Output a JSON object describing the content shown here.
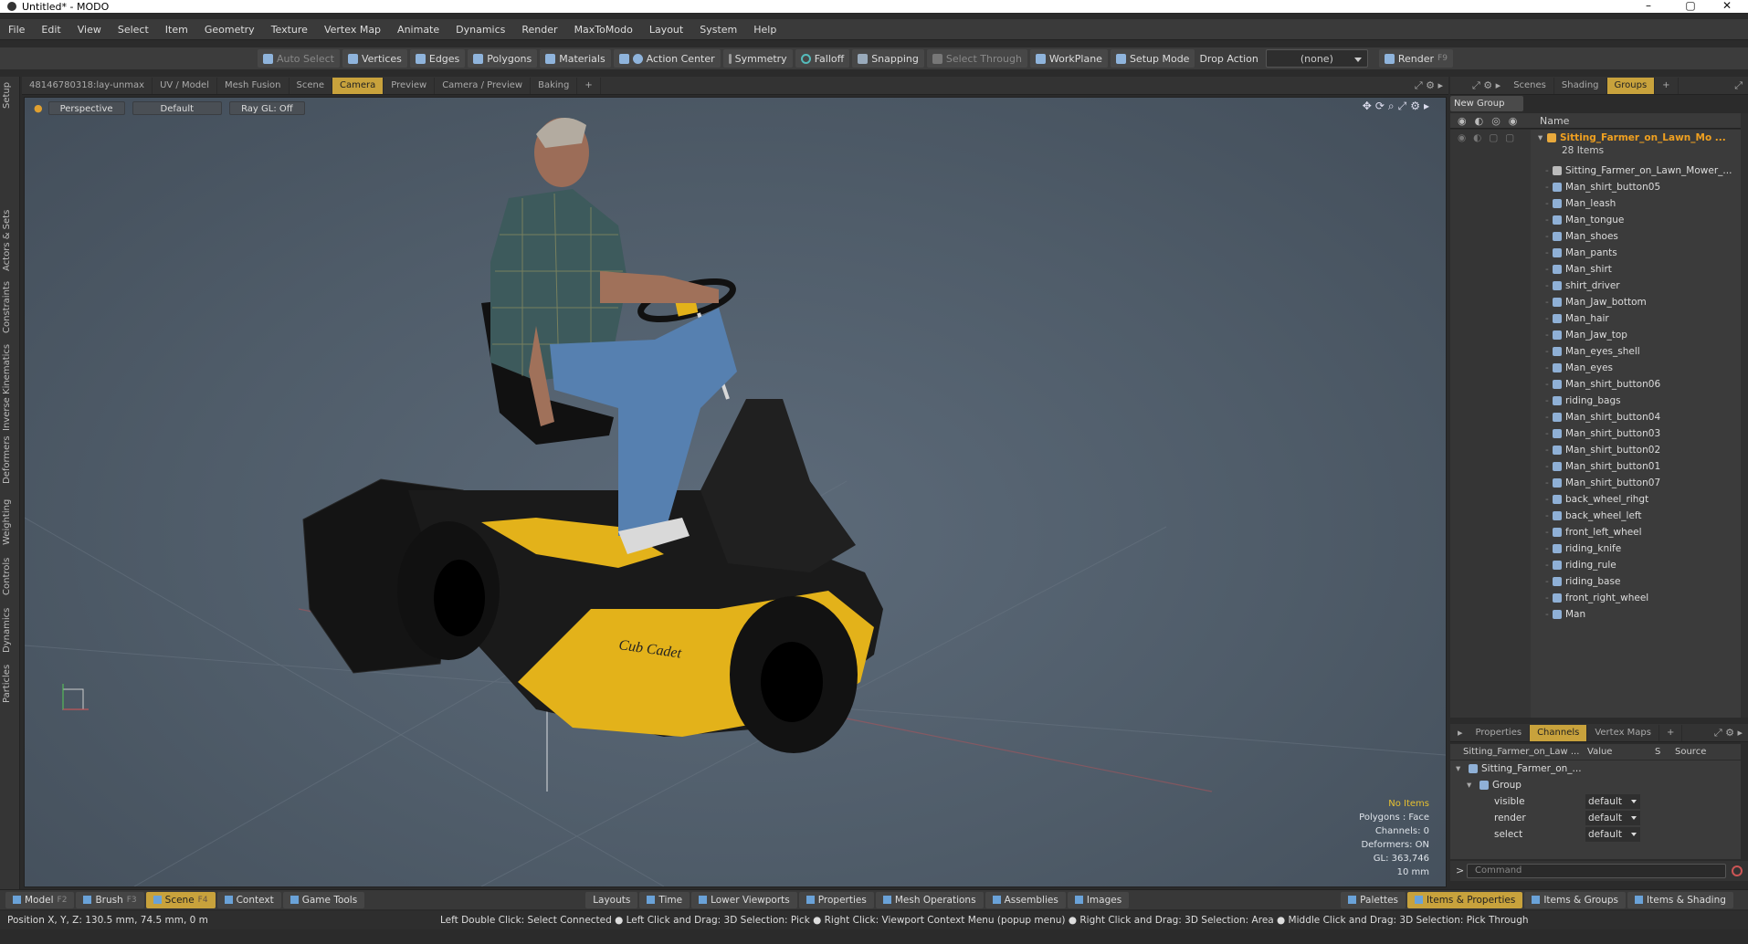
{
  "window": {
    "title": "Untitled* - MODO",
    "min": "–",
    "max": "▢",
    "close": "✕"
  },
  "menu": [
    "File",
    "Edit",
    "View",
    "Select",
    "Item",
    "Geometry",
    "Texture",
    "Vertex Map",
    "Animate",
    "Dynamics",
    "Render",
    "MaxToModo",
    "Layout",
    "System",
    "Help"
  ],
  "toolbar": {
    "auto_select": "Auto Select",
    "vertices": "Vertices",
    "edges": "Edges",
    "polygons": "Polygons",
    "materials": "Materials",
    "action_center": "Action Center",
    "symmetry": "Symmetry",
    "falloff": "Falloff",
    "snapping": "Snapping",
    "select_through": "Select Through",
    "workplane": "WorkPlane",
    "setup_mode": "Setup Mode",
    "drop_action": "Drop Action",
    "drop_value": "(none)",
    "render": "Render",
    "render_key": "F9"
  },
  "left_tabs": [
    "Setup",
    "Actors & Sets",
    "Constraints",
    "Inverse Kinematics",
    "Deformers",
    "Weighting",
    "Controls",
    "Dynamics",
    "Particles"
  ],
  "viewport_tabs": [
    "48146780318:lay-unmax",
    "UV / Model",
    "Mesh Fusion",
    "Scene",
    "Camera",
    "Preview",
    "Camera / Preview",
    "Baking",
    "+"
  ],
  "viewport": {
    "projection": "Perspective",
    "style": "Default",
    "raygl": "Ray GL: Off",
    "brand": "Cub Cadet",
    "info": {
      "items": "No Items",
      "polygons": "Polygons : Face",
      "channels": "Channels: 0",
      "deformers": "Deformers: ON",
      "gl": "GL: 363,746",
      "scale": "10 mm"
    }
  },
  "right_tabs": [
    "Scenes",
    "Shading",
    "Groups",
    "+"
  ],
  "groups": {
    "new_group": "New Group",
    "name_header": "Name",
    "root": "Sitting_Farmer_on_Lawn_Mo ...",
    "count": "28 Items",
    "items": [
      "Sitting_Farmer_on_Lawn_Mower_...",
      "Man_shirt_button05",
      "Man_leash",
      "Man_tongue",
      "Man_shoes",
      "Man_pants",
      "Man_shirt",
      "shirt_driver",
      "Man_Jaw_bottom",
      "Man_hair",
      "Man_Jaw_top",
      "Man_eyes_shell",
      "Man_eyes",
      "Man_shirt_button06",
      "riding_bags",
      "Man_shirt_button04",
      "Man_shirt_button03",
      "Man_shirt_button02",
      "Man_shirt_button01",
      "Man_shirt_button07",
      "back_wheel_rihgt",
      "back_wheel_left",
      "front_left_wheel",
      "riding_knife",
      "riding_rule",
      "riding_base",
      "front_right_wheel",
      "Man"
    ]
  },
  "channel_tabs": [
    "Properties",
    "Channels",
    "Vertex Maps",
    "+"
  ],
  "channels": {
    "header": {
      "name": "Sitting_Farmer_on_Law ...",
      "value": "Value",
      "s": "S",
      "source": "Source"
    },
    "item": "Sitting_Farmer_on_...",
    "group": "Group",
    "rows": [
      {
        "name": "visible",
        "value": "default"
      },
      {
        "name": "render",
        "value": "default"
      },
      {
        "name": "select",
        "value": "default"
      }
    ]
  },
  "command": {
    "prompt": ">",
    "placeholder": "Command"
  },
  "bottom": {
    "left": [
      {
        "label": "Model",
        "key": "F2"
      },
      {
        "label": "Brush",
        "key": "F3"
      },
      {
        "label": "Scene",
        "key": "F4"
      },
      {
        "label": "Context",
        "key": ""
      },
      {
        "label": "Game Tools",
        "key": ""
      }
    ],
    "center": [
      "Layouts",
      "Time",
      "Lower Viewports",
      "Properties",
      "Mesh Operations",
      "Assemblies",
      "Images"
    ],
    "right": [
      "Palettes",
      "Items & Properties",
      "Items & Groups",
      "Items & Shading"
    ]
  },
  "status": {
    "position": "Position X, Y, Z:   130.5 mm, 74.5 mm, 0 m",
    "hint": "Left Double Click: Select Connected ● Left Click and Drag: 3D Selection: Pick ● Right Click: Viewport Context Menu (popup menu) ● Right Click and Drag: 3D Selection: Area ● Middle Click and Drag: 3D Selection: Pick Through"
  },
  "colors": {
    "accent": "#c8a23c",
    "mower_yellow": "#e3b21a",
    "root_orange": "#f0a020"
  }
}
